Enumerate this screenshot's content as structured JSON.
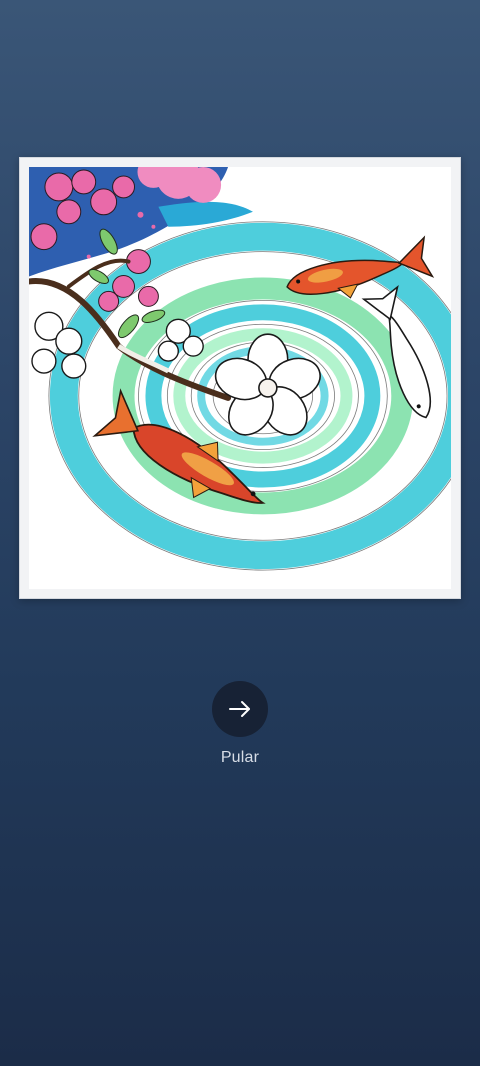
{
  "artwork": {
    "image_name": "koi-pond-coloring-image"
  },
  "navigation": {
    "next_icon": "arrow-right-icon",
    "skip_label": "Pular"
  },
  "colors": {
    "background_top": "#3a5677",
    "background_bottom": "#1b2c48",
    "button_fill": "#172235",
    "water_cyan": "#2fc6d6",
    "water_green": "#7fe0a8",
    "blossom_pink": "#e96aa9",
    "koi_orange": "#e4552c"
  }
}
